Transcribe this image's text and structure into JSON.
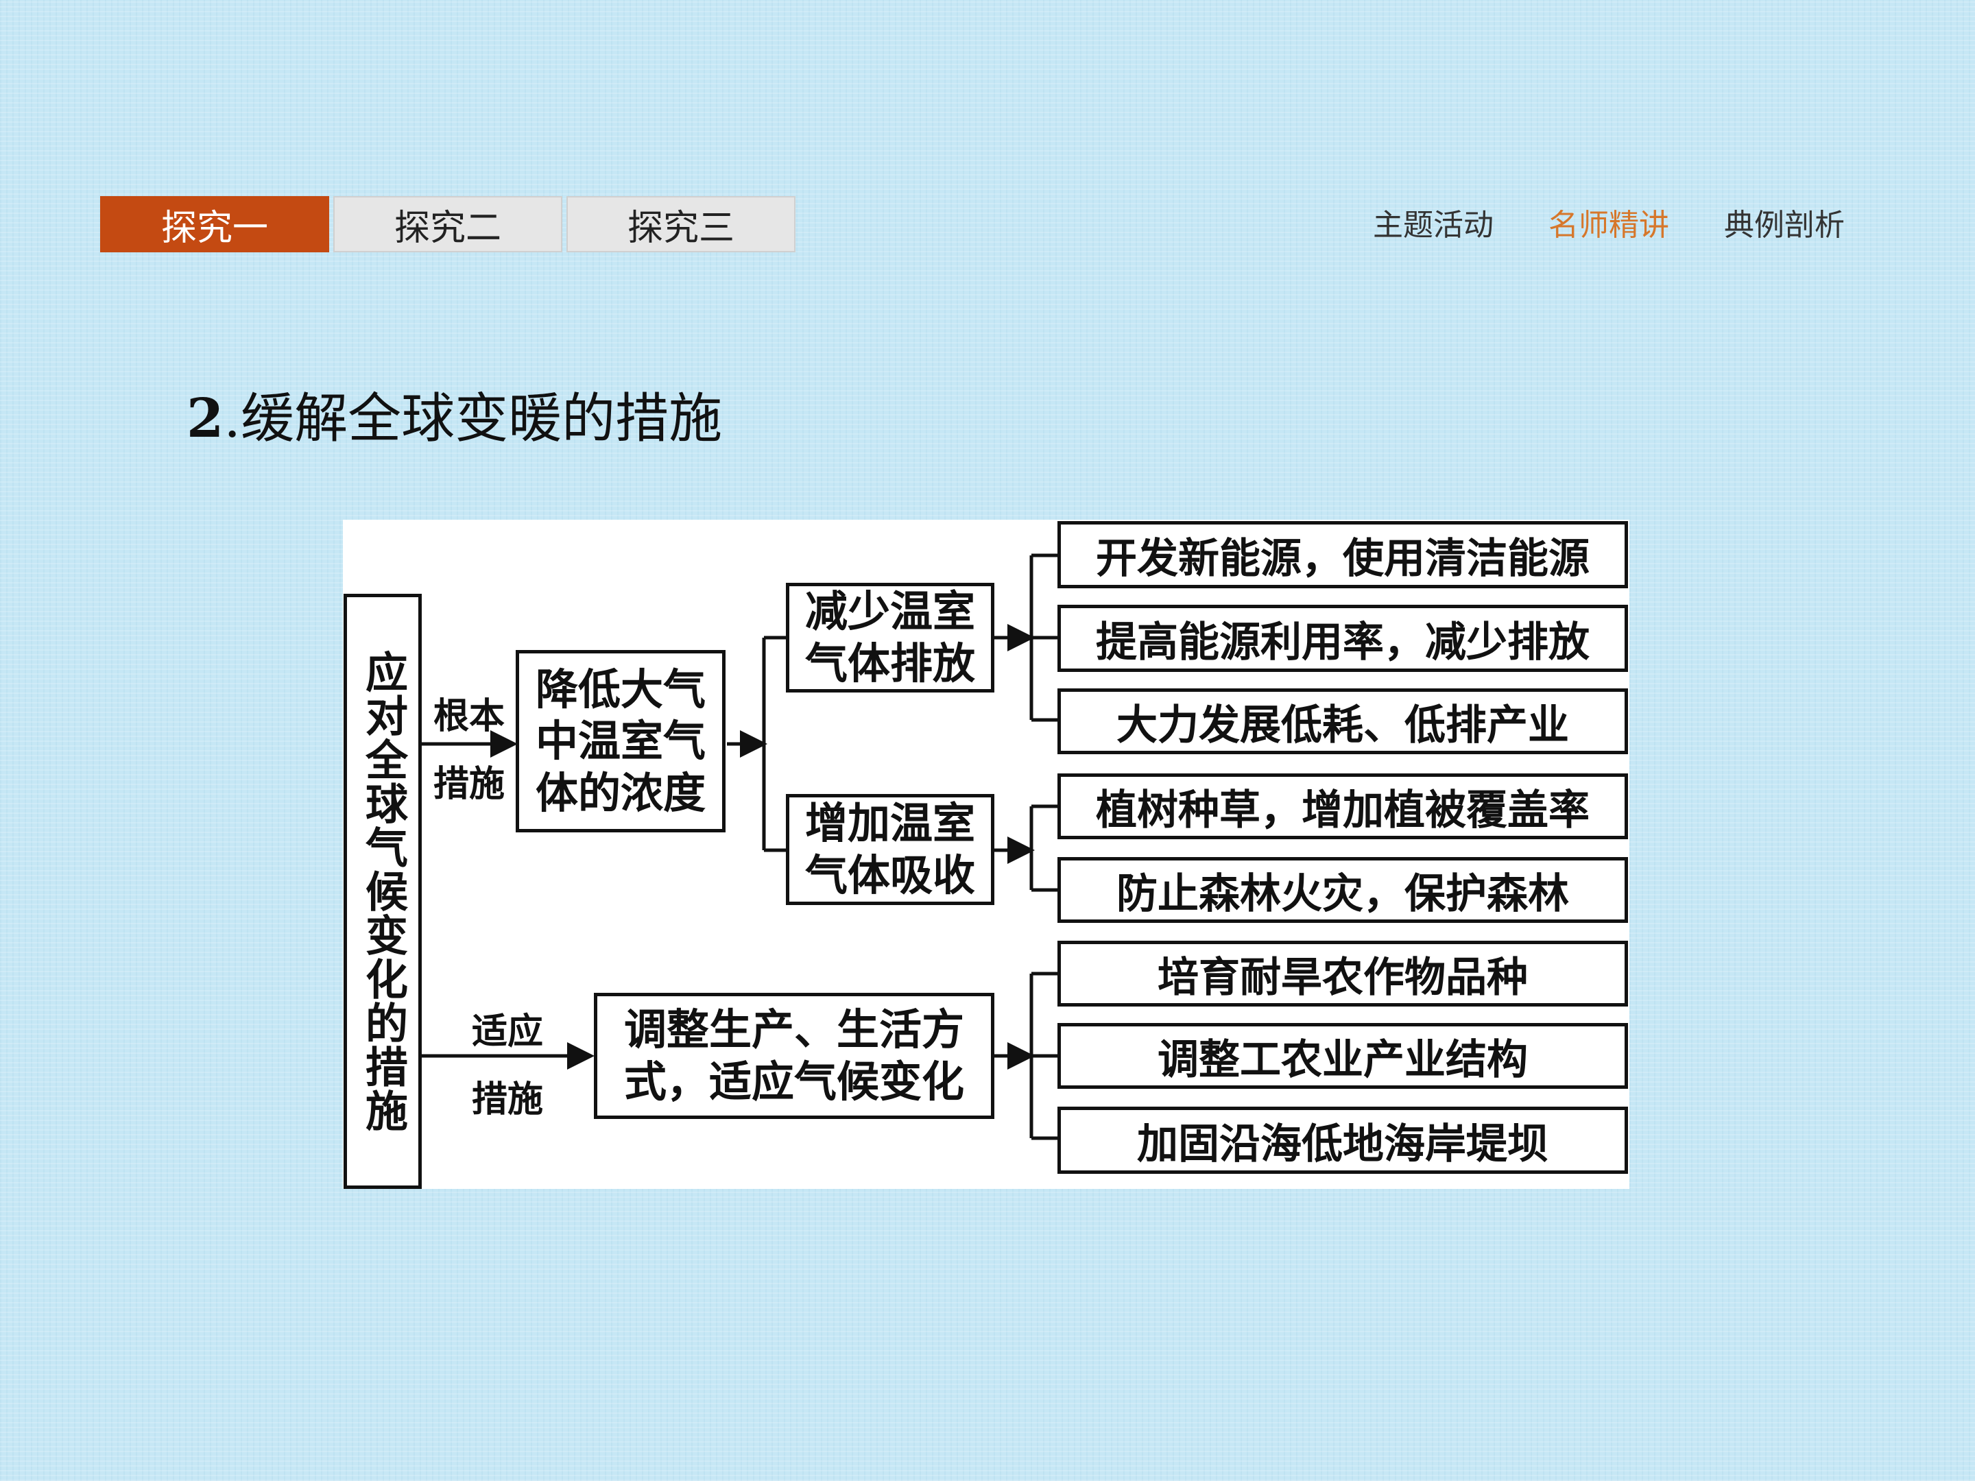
{
  "tabs": [
    {
      "label": "探究一",
      "active": true
    },
    {
      "label": "探究二",
      "active": false
    },
    {
      "label": "探究三",
      "active": false
    }
  ],
  "nav": [
    {
      "label": "主题活动",
      "active": false
    },
    {
      "label": "名师精讲",
      "active": true
    },
    {
      "label": "典例剖析",
      "active": false
    }
  ],
  "heading": {
    "number": "2",
    "title": ".缓解全球变暖的措施"
  },
  "diagram": {
    "root": "应对全球气候变化的措施",
    "edges": {
      "fundamental": "根本\n措施",
      "adapt": "适应\n措施"
    },
    "reduce_concentration": "降低大气中温室气体的浓度",
    "reduce_emission": "减少温室气体排放",
    "increase_absorption": "增加温室气体吸收",
    "adjust_lifestyle": "调整生产、生活方式，适应气候变化",
    "leaves": {
      "new_energy": "开发新能源，使用清洁能源",
      "efficiency": "提高能源利用率，减少排放",
      "low_industry": "大力发展低耗、低排产业",
      "plant": "植树种草，增加植被覆盖率",
      "forest": "防止森林火灾，保护森林",
      "crops": "培育耐旱农作物品种",
      "structure": "调整工农业产业结构",
      "dams": "加固沿海低地海岸堤坝"
    }
  },
  "colors": {
    "tab_active": "#c44a12",
    "nav_active": "#d6772b",
    "background": "#c6e7f5"
  }
}
